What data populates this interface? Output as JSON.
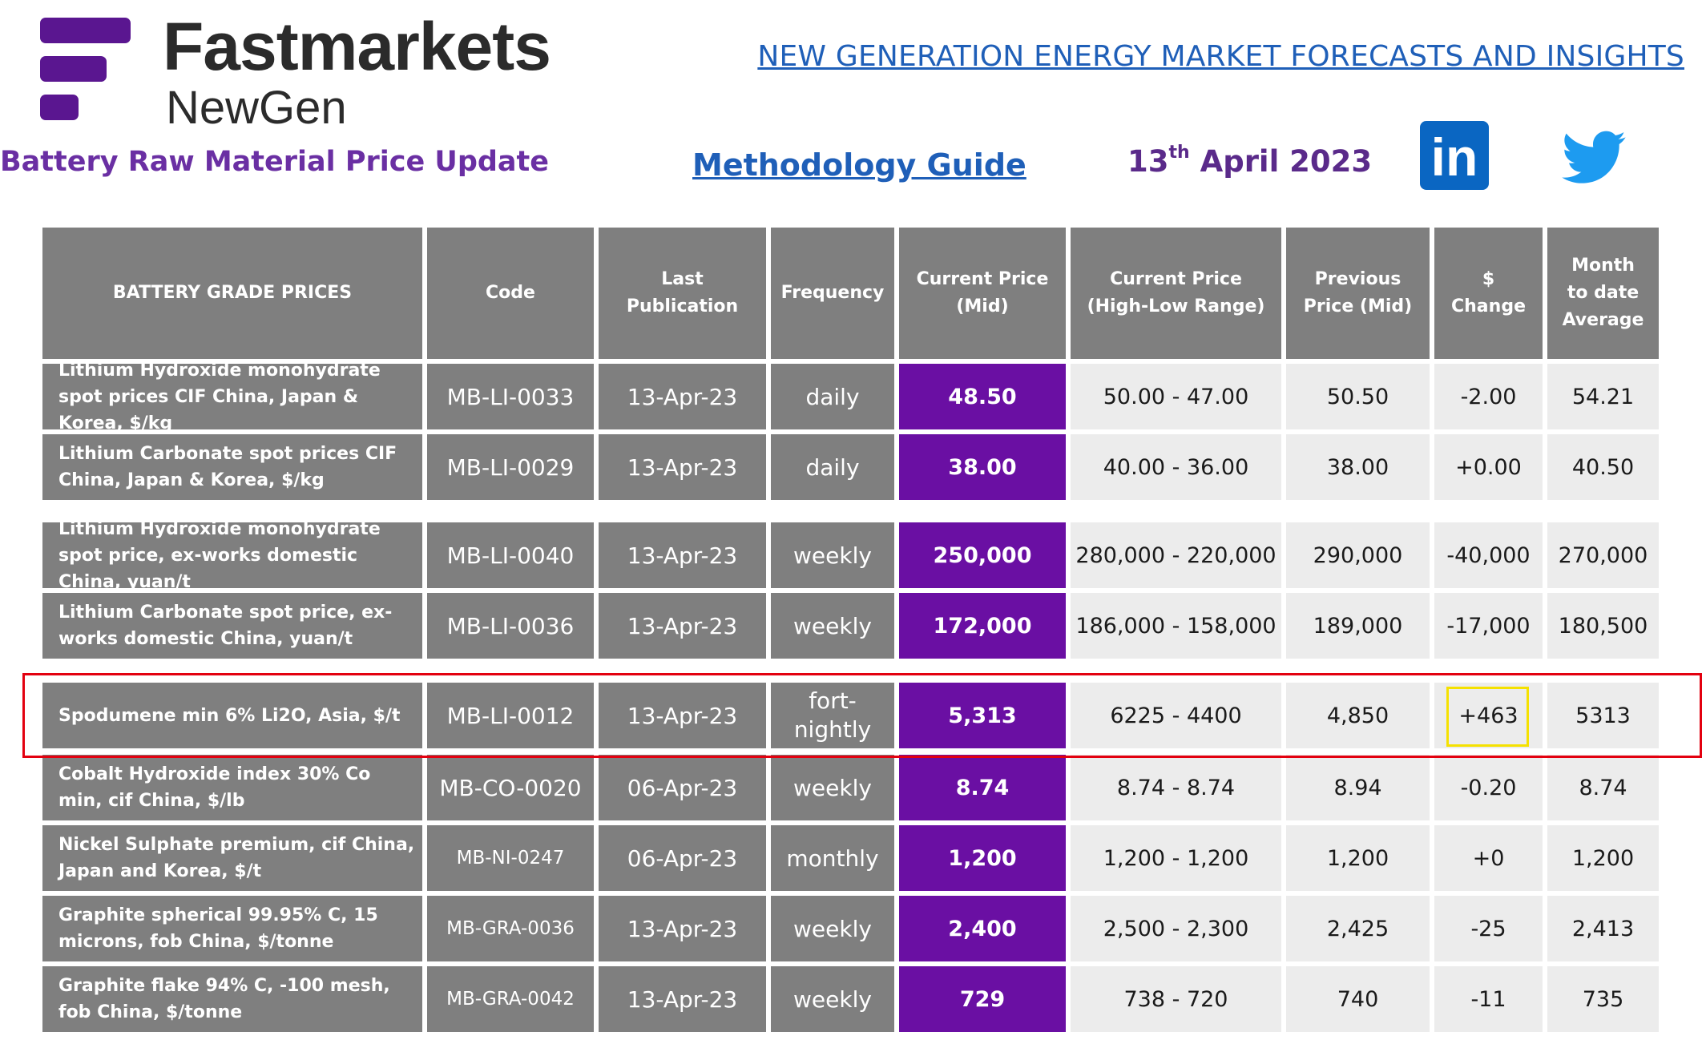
{
  "brand": {
    "name": "Fastmarkets",
    "sub": "NewGen",
    "colors": {
      "purple": "#5a1690",
      "price_cell": "#6a0fa3",
      "header_gray": "#7f7f7f",
      "link_blue": "#1f5fb8"
    }
  },
  "header": {
    "top_link": "NEW GENERATION ENERGY MARKET FORECASTS AND INSIGHTS",
    "subtitle": "Battery Raw Material Price Update",
    "methodology_link": "Methodology Guide",
    "date_day": "13",
    "date_suffix": "th",
    "date_rest": " April 2023",
    "social_icons": [
      "linkedin-icon",
      "twitter-icon"
    ],
    "linkedin_text": "in"
  },
  "table": {
    "columns": [
      "BATTERY GRADE PRICES",
      "Code",
      "Last Publication",
      "Frequency",
      "Current Price (Mid)",
      "Current Price (High-Low Range)",
      "Previous Price (Mid)",
      "$ Change",
      "Month to date Average"
    ],
    "rows": [
      {
        "name": "Lithium Hydroxide monohydrate spot prices CIF China, Japan & Korea, $/kg",
        "code": "MB-LI-0033",
        "last": "13-Apr-23",
        "freq": "daily",
        "mid": "48.50",
        "range": "50.00 - 47.00",
        "prev": "50.50",
        "change": "-2.00",
        "mtd": "54.21"
      },
      {
        "name": "Lithium Carbonate spot prices CIF China, Japan & Korea, $/kg",
        "code": "MB-LI-0029",
        "last": "13-Apr-23",
        "freq": "daily",
        "mid": "38.00",
        "range": "40.00 - 36.00",
        "prev": "38.00",
        "change": "+0.00",
        "mtd": "40.50"
      },
      {
        "name": "Lithium Hydroxide monohydrate spot price, ex-works domestic China, yuan/t",
        "code": "MB-LI-0040",
        "last": "13-Apr-23",
        "freq": "weekly",
        "mid": "250,000",
        "range": "280,000 - 220,000",
        "prev": "290,000",
        "change": "-40,000",
        "mtd": "270,000"
      },
      {
        "name": "Lithium Carbonate spot price, ex-works domestic China, yuan/t",
        "code": "MB-LI-0036",
        "last": "13-Apr-23",
        "freq": "weekly",
        "mid": "172,000",
        "range": "186,000 - 158,000",
        "prev": "189,000",
        "change": "-17,000",
        "mtd": "180,500"
      },
      {
        "name": "Spodumene min 6% Li2O, Asia, $/t",
        "code": "MB-LI-0012",
        "last": "13-Apr-23",
        "freq_line1": "fort-",
        "freq_line2": "nightly",
        "mid": "5,313",
        "range": "6225 - 4400",
        "prev": "4,850",
        "change": "+463",
        "mtd": "5313"
      },
      {
        "name": "Cobalt Hydroxide index 30% Co min, cif China, $/lb",
        "code": "MB-CO-0020",
        "last": "06-Apr-23",
        "freq": "weekly",
        "mid": "8.74",
        "range": "8.74 - 8.74",
        "prev": "8.94",
        "change": "-0.20",
        "mtd": "8.74"
      },
      {
        "name": "Nickel Sulphate premium, cif China, Japan and Korea, $/t",
        "code": "MB-NI-0247",
        "last": "06-Apr-23",
        "freq": "monthly",
        "mid": "1,200",
        "range": "1,200 - 1,200",
        "prev": "1,200",
        "change": "+0",
        "mtd": "1,200"
      },
      {
        "name": "Graphite spherical 99.95% C, 15 microns, fob China, $/tonne",
        "code": "MB-GRA-0036",
        "last": "13-Apr-23",
        "freq": "weekly",
        "mid": "2,400",
        "range": "2,500 - 2,300",
        "prev": "2,425",
        "change": "-25",
        "mtd": "2,413"
      },
      {
        "name": "Graphite flake 94% C, -100 mesh, fob China, $/tonne",
        "code": "MB-GRA-0042",
        "last": "13-Apr-23",
        "freq": "weekly",
        "mid": "729",
        "range": "738 - 720",
        "prev": "740",
        "change": "-11",
        "mtd": "735"
      }
    ]
  }
}
